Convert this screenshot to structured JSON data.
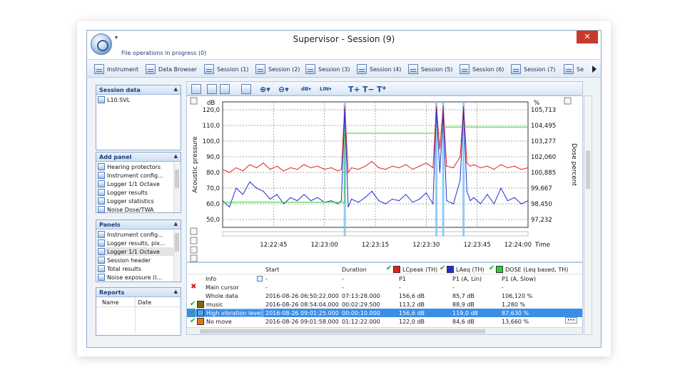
{
  "window": {
    "title": "Supervisor - Session (9)",
    "status": "File operations in progress (0)",
    "close_glyph": "✕",
    "qa_glyph": "▾"
  },
  "tabs": [
    {
      "label": "Instrument",
      "icon": "instrument-icon"
    },
    {
      "label": "Data Browser",
      "icon": "data-browser-icon"
    },
    {
      "label": "Session (1)",
      "icon": "session-icon"
    },
    {
      "label": "Session (2)",
      "icon": "session-icon"
    },
    {
      "label": "Session (3)",
      "icon": "session-icon"
    },
    {
      "label": "Session (4)",
      "icon": "session-icon"
    },
    {
      "label": "Session (5)",
      "icon": "session-icon"
    },
    {
      "label": "Session (6)",
      "icon": "session-icon"
    },
    {
      "label": "Session (7)",
      "icon": "session-icon"
    },
    {
      "label": "Se",
      "icon": "session-icon"
    }
  ],
  "panels": {
    "session_data": {
      "title": "Session data",
      "items": [
        "L10.SVL"
      ]
    },
    "add_panel": {
      "title": "Add panel",
      "items": [
        "Hearing protectors",
        "Instrument config...",
        "Logger 1/1 Octave",
        "Logger results",
        "Logger statistics",
        "Noise Dose/TWA"
      ]
    },
    "panels": {
      "title": "Panels",
      "items": [
        "Instrument config...",
        "Logger results, pix...",
        "Logger 1/1 Octave",
        "Session header",
        "Total results",
        "Noise exposure (l..."
      ]
    },
    "reports": {
      "title": "Reports",
      "col_name": "Name",
      "col_date": "Date"
    }
  },
  "toolbar": {
    "t_plus": "T+",
    "t_minus": "T−",
    "t_star": "T*",
    "db": "dB",
    "lin": "LIN"
  },
  "chart_data": {
    "type": "line",
    "ylabel": "Acoustic pressure",
    "ylabel_right": "Dose percent",
    "unit_left": "dB",
    "unit_right": "%",
    "x_unit": "Time",
    "yticks": [
      "120,0",
      "110,0",
      "100,0",
      "90,0",
      "80,0",
      "70,0",
      "60,0",
      "50,0"
    ],
    "yticks_values": [
      120,
      110,
      100,
      90,
      80,
      70,
      60,
      50
    ],
    "ylim": [
      45,
      125
    ],
    "yticks_right": [
      "105,713",
      "104,495",
      "103,277",
      "102,060",
      "100,885",
      "99,667",
      "98,450",
      "97,232"
    ],
    "xticks": [
      "12:22:45",
      "12:23:00",
      "12:23:15",
      "12:23:30",
      "12:23:45",
      "12:24:00"
    ],
    "xlim_seconds": [
      0,
      90
    ],
    "xticks_seconds": [
      15,
      30,
      45,
      60,
      75,
      90
    ],
    "grid": true,
    "series": [
      {
        "name": "LCpeak (TH)",
        "color": "#e02020",
        "x": [
          0,
          2,
          4,
          6,
          8,
          10,
          12,
          14,
          16,
          18,
          20,
          22,
          24,
          26,
          28,
          30,
          32,
          34,
          35,
          36,
          37,
          38,
          40,
          42,
          44,
          46,
          48,
          50,
          52,
          54,
          56,
          58,
          60,
          62,
          63,
          64,
          65,
          66,
          68,
          70,
          71,
          72,
          73,
          74,
          76,
          78,
          80,
          82,
          84,
          86,
          88,
          90
        ],
        "y": [
          82,
          80,
          83,
          81,
          85,
          83,
          86,
          82,
          84,
          81,
          83,
          82,
          85,
          83,
          84,
          82,
          83,
          81,
          82,
          122,
          80,
          83,
          82,
          84,
          87,
          83,
          82,
          84,
          83,
          85,
          82,
          84,
          86,
          83,
          122,
          95,
          122,
          84,
          83,
          90,
          122,
          86,
          84,
          85,
          83,
          84,
          82,
          85,
          83,
          84,
          82,
          83
        ]
      },
      {
        "name": "LAeq (TH)",
        "color": "#1f2fd0",
        "x": [
          0,
          2,
          4,
          6,
          8,
          10,
          12,
          14,
          16,
          18,
          20,
          22,
          24,
          26,
          28,
          30,
          32,
          34,
          35,
          36,
          37,
          38,
          40,
          42,
          44,
          46,
          48,
          50,
          52,
          54,
          56,
          58,
          60,
          62,
          63,
          64,
          65,
          66,
          68,
          70,
          71,
          72,
          73,
          74,
          76,
          78,
          80,
          82,
          84,
          86,
          88,
          90
        ],
        "y": [
          62,
          58,
          70,
          66,
          74,
          70,
          68,
          63,
          66,
          60,
          64,
          62,
          66,
          62,
          64,
          61,
          62,
          60,
          62,
          120,
          58,
          63,
          61,
          64,
          68,
          62,
          60,
          63,
          62,
          66,
          61,
          63,
          67,
          60,
          120,
          80,
          118,
          62,
          60,
          75,
          120,
          68,
          62,
          64,
          60,
          66,
          60,
          70,
          62,
          64,
          60,
          62
        ]
      },
      {
        "name": "DOSE (Leq based, TH)",
        "color": "#2ed02e",
        "x": [
          0,
          36,
          36,
          65,
          65,
          90
        ],
        "y": [
          61,
          61,
          105,
          105,
          109,
          109
        ]
      }
    ],
    "markers_x": [
      36,
      63,
      65,
      71
    ]
  },
  "grid_table": {
    "headers": {
      "start": "Start",
      "duration": "Duration",
      "lcpeak": "LCpeak (TH)",
      "laeq": "LAeq (TH)",
      "dose": "DOSE (Leq based, TH)"
    },
    "subheader": {
      "info": "Info",
      "start": "-",
      "duration": "-",
      "lcpeak": "P1",
      "laeq": "P1 (A, Lin)",
      "dose": "P1 (A, Slow)"
    },
    "colors": {
      "lcpeak": "#e02020",
      "laeq": "#1f2fd0",
      "dose": "#2ed02e"
    },
    "rows": [
      {
        "label": "Main cursor",
        "start": "-",
        "duration": "-",
        "lcpeak": "-",
        "laeq": "-",
        "dose": "-",
        "mark": "x"
      },
      {
        "label": "Whole data",
        "start": "2016-08-26 06:50:22.000",
        "duration": "07:13:28.000",
        "lcpeak": "156,6 dB",
        "laeq": "85,7 dB",
        "dose": "106,120 %",
        "mark": ""
      },
      {
        "label": "music",
        "start": "2016-08-26 08:54:04.000",
        "duration": "00:02:29.500",
        "lcpeak": "113,2 dB",
        "laeq": "88,9 dB",
        "dose": "1,280 %",
        "mark": "check",
        "swatch": "#7a6a10"
      },
      {
        "label": "High vibration level",
        "start": "2016-08-26 09:01:25.000",
        "duration": "00:00:10.000",
        "lcpeak": "156,6 dB",
        "laeq": "119,0 dB",
        "dose": "87,630 %",
        "mark": "check",
        "swatch": "#4aa7ee",
        "highlight": true
      },
      {
        "label": "No move",
        "start": "2016-08-26 09:01:58.000",
        "duration": "01:12:22.000",
        "lcpeak": "122,0 dB",
        "laeq": "84,6 dB",
        "dose": "13,660 %",
        "mark": "check",
        "swatch": "#e07818"
      }
    ],
    "more_glyph": "•••"
  }
}
